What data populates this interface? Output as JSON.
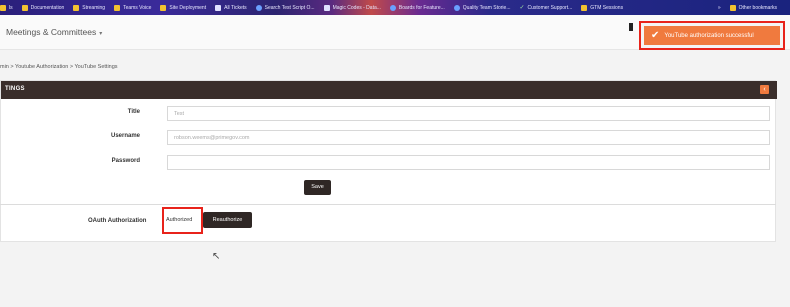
{
  "bookmarks": {
    "items": [
      {
        "label": "ls",
        "icon": "folder"
      },
      {
        "label": "Documentation",
        "icon": "folder"
      },
      {
        "label": "Streaming",
        "icon": "folder"
      },
      {
        "label": "Teams Voice",
        "icon": "folder"
      },
      {
        "label": "Site Deployment",
        "icon": "folder"
      },
      {
        "label": "All Tickets",
        "icon": "check"
      },
      {
        "label": "Search Test Script O...",
        "icon": "globe"
      },
      {
        "label": "Magic Codes - Data...",
        "icon": "check"
      },
      {
        "label": "Boards for Feature...",
        "icon": "globe"
      },
      {
        "label": "Quality Team Storie...",
        "icon": "globe"
      },
      {
        "label": "Customer Support...",
        "icon": "tick"
      },
      {
        "label": "GTM Sessions",
        "icon": "folder"
      }
    ],
    "more": "»",
    "other": "Other bookmarks"
  },
  "header": {
    "nav_label": "Meetings & Committees",
    "caret": "▾"
  },
  "toast": {
    "message": "YouTube authorization successful",
    "icon": "check-icon",
    "color": "#f07a3e"
  },
  "breadcrumb": "min > Youtube Authorization > YouTube Settings",
  "panel": {
    "title": "TINGS",
    "collapse_glyph": "‹",
    "title_label": "Title",
    "title_value": "Test",
    "username_label": "Username",
    "username_value": "robson.weems@primegov.com",
    "password_label": "Password",
    "password_value": "",
    "save_label": "Save",
    "oauth_label": "OAuth Authorization",
    "oauth_status": "Authorized",
    "reauthorize_label": "Reauthorize"
  },
  "colors": {
    "accent": "#f07a3e",
    "panel_header": "#3a2e2b",
    "highlight_box": "#e8231b"
  }
}
